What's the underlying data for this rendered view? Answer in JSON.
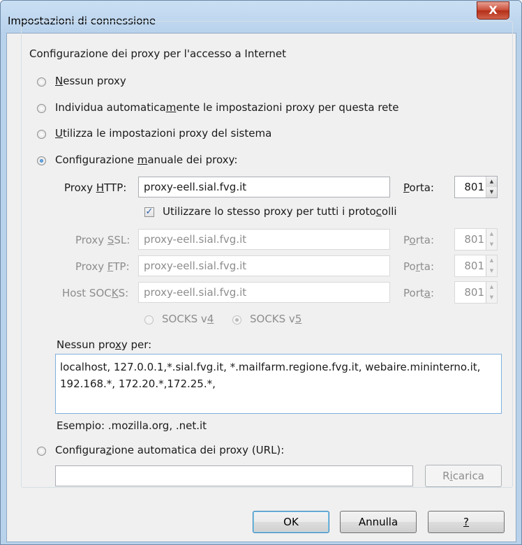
{
  "window": {
    "title": "Impostazioni di connessione",
    "close_glyph": "X"
  },
  "group": {
    "legend": "Configurazione dei proxy per l'accesso a Internet"
  },
  "radios": {
    "none": {
      "pre": "",
      "key": "N",
      "post": "essun proxy",
      "checked": false
    },
    "auto_detect": {
      "pre": "Individua automatica",
      "key": "m",
      "post": "ente le impostazioni proxy per questa rete",
      "checked": false
    },
    "system": {
      "pre": "",
      "key": "U",
      "post": "tilizza le impostazioni proxy del sistema",
      "checked": false
    },
    "manual": {
      "pre": "Configurazione ",
      "key": "m",
      "post": "anuale dei proxy:",
      "checked": true
    },
    "auto_url": {
      "pre": "Configura",
      "key": "z",
      "post": "ione automatica dei proxy (URL):",
      "checked": false
    }
  },
  "http": {
    "label_pre": "Proxy ",
    "label_key": "H",
    "label_post": "TTP:",
    "value": "proxy-eell.sial.fvg.it",
    "port_label_pre": "",
    "port_label_key": "P",
    "port_label_post": "orta:",
    "port": "801"
  },
  "same_proxy": {
    "checked": true,
    "check_glyph": "✓",
    "pre": "Utilizzare lo stesso proxy per tutti i proto",
    "key": "c",
    "post": "olli"
  },
  "ssl": {
    "label_pre": "Proxy ",
    "label_key": "S",
    "label_post": "SL:",
    "value": "proxy-eell.sial.fvg.it",
    "port_label_pre": "P",
    "port_label_key": "o",
    "port_label_post": "rta:",
    "port": "801"
  },
  "ftp": {
    "label_pre": "Proxy ",
    "label_key": "F",
    "label_post": "TP:",
    "value": "proxy-eell.sial.fvg.it",
    "port_label_pre": "Po",
    "port_label_key": "r",
    "port_label_post": "ta:",
    "port": "801"
  },
  "socks": {
    "label_pre": "Host SOC",
    "label_key": "K",
    "label_post": "S:",
    "value": "proxy-eell.sial.fvg.it",
    "port_label_pre": "Port",
    "port_label_key": "a",
    "port_label_post": ":",
    "port": "801",
    "v4_pre": "SOCKS v",
    "v4_key": "4",
    "v5_pre": "SOCKS v",
    "v5_key": "5",
    "v5_checked": true
  },
  "no_proxy": {
    "label_pre": "Nessun pro",
    "label_key": "x",
    "label_post": "y per:",
    "value": "localhost, 127.0.0.1,*.sial.fvg.it, *.mailfarm.regione.fvg.it, webaire.mininterno.it, 192.168.*, 172.20.*,172.25.*,",
    "example": "Esempio: .mozilla.org, .net.it"
  },
  "auto_url": {
    "value": "",
    "reload_pre": "R",
    "reload_key": "i",
    "reload_post": "carica"
  },
  "buttons": {
    "ok": "OK",
    "cancel": "Annulla",
    "help": "?"
  },
  "spinner_glyphs": {
    "up": "▲",
    "down": "▼"
  }
}
